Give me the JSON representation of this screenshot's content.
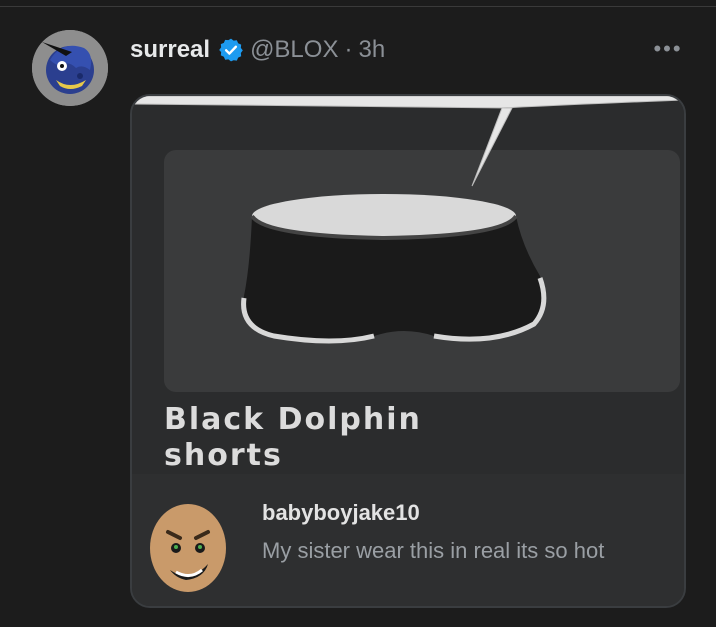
{
  "post": {
    "display_name": "surreal",
    "handle": "@BLOX",
    "separator": "·",
    "time": "3h",
    "more_label": "•••"
  },
  "icons": {
    "verified": "verified-badge-icon",
    "more": "more-options-icon"
  },
  "colors": {
    "background": "#1c1c1c",
    "verified_blue": "#1d9bf0",
    "muted_text": "#8b9096"
  },
  "card": {
    "item_title_line1": "Black Dolphin",
    "item_title_line2": "shorts",
    "comment": {
      "username": "babyboyjake10",
      "text": "My sister wear this in real its so hot"
    }
  }
}
